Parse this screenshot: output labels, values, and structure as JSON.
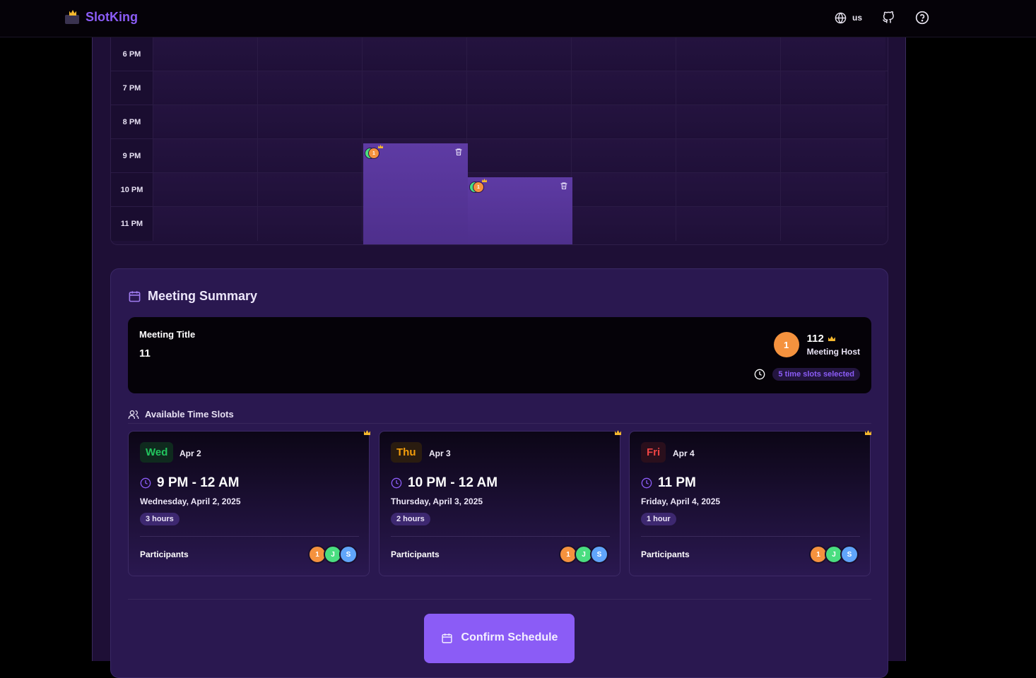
{
  "header": {
    "app_name": "SlotKing",
    "lang_code": "us",
    "icons": [
      "globe-icon",
      "github-icon",
      "help-icon"
    ]
  },
  "calendar": {
    "time_labels": [
      "6 PM",
      "7 PM",
      "8 PM",
      "9 PM",
      "10 PM",
      "11 PM"
    ],
    "slot_badges": [
      "1",
      "1"
    ]
  },
  "summary": {
    "title": "Meeting Summary",
    "meeting_title_label": "Meeting Title",
    "meeting_title_value": "11",
    "host_initial": "1",
    "host_name": "112",
    "host_role": "Meeting Host",
    "slots_selected": "5 time slots selected",
    "available_label": "Available Time Slots",
    "participants_label": "Participants",
    "confirm_label": "Confirm Schedule"
  },
  "slots": [
    {
      "day": "Wed",
      "date": "Apr 2",
      "range": "9 PM - 12 AM",
      "full_date": "Wednesday, April 2, 2025",
      "duration": "3 hours",
      "participants": [
        "1",
        "J",
        "S"
      ]
    },
    {
      "day": "Thu",
      "date": "Apr 3",
      "range": "10 PM - 12 AM",
      "full_date": "Thursday, April 3, 2025",
      "duration": "2 hours",
      "participants": [
        "1",
        "J",
        "S"
      ]
    },
    {
      "day": "Fri",
      "date": "Apr 4",
      "range": "11 PM",
      "full_date": "Friday, April 4, 2025",
      "duration": "1 hour",
      "participants": [
        "1",
        "J",
        "S"
      ]
    }
  ],
  "colors": {
    "accent": "#8b5cf6",
    "wed_text": "#22c55e",
    "wed_bg": "#0f2a1e",
    "thu_text": "#f59e0b",
    "thu_bg": "#2a1c10",
    "fri_text": "#ef4444",
    "fri_bg": "#2a0f1c",
    "avatar_orange": "#f5923e",
    "avatar_green": "#4ade80",
    "avatar_blue": "#60a5fa"
  }
}
